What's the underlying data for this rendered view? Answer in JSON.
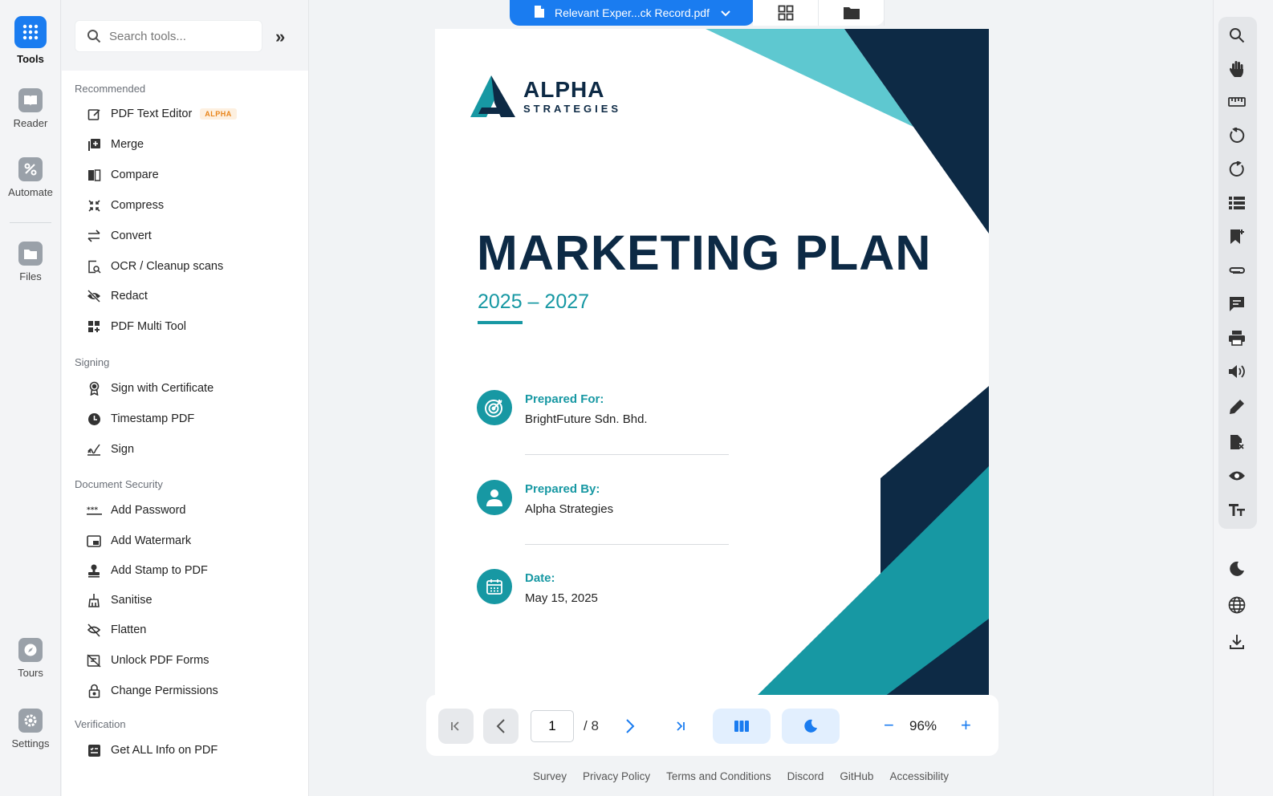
{
  "rail": {
    "items": [
      {
        "label": "Tools"
      },
      {
        "label": "Reader"
      },
      {
        "label": "Automate"
      },
      {
        "label": "Files"
      },
      {
        "label": "Tours"
      },
      {
        "label": "Settings"
      }
    ]
  },
  "tools_panel": {
    "search_placeholder": "Search tools...",
    "sections": [
      {
        "title": "Recommended",
        "items": [
          {
            "label": "PDF Text Editor",
            "badge": "ALPHA"
          },
          {
            "label": "Merge"
          },
          {
            "label": "Compare"
          },
          {
            "label": "Compress"
          },
          {
            "label": "Convert"
          },
          {
            "label": "OCR / Cleanup scans"
          },
          {
            "label": "Redact"
          },
          {
            "label": "PDF Multi Tool"
          }
        ]
      },
      {
        "title": "Signing",
        "items": [
          {
            "label": "Sign with Certificate"
          },
          {
            "label": "Timestamp PDF"
          },
          {
            "label": "Sign"
          }
        ]
      },
      {
        "title": "Document Security",
        "items": [
          {
            "label": "Add Password"
          },
          {
            "label": "Add Watermark"
          },
          {
            "label": "Add Stamp to PDF"
          },
          {
            "label": "Sanitise"
          },
          {
            "label": "Flatten"
          },
          {
            "label": "Unlock PDF Forms"
          },
          {
            "label": "Change Permissions"
          }
        ]
      },
      {
        "title": "Verification",
        "items": [
          {
            "label": "Get ALL Info on PDF"
          }
        ]
      }
    ]
  },
  "viewer": {
    "file_name": "Relevant Exper...ck Record.pdf",
    "document": {
      "brand_line1": "ALPHA",
      "brand_line2": "STRATEGIES",
      "title": "MARKETING PLAN",
      "years": "2025 – 2027",
      "info": [
        {
          "label": "Prepared For:",
          "value": "BrightFuture Sdn. Bhd."
        },
        {
          "label": "Prepared By:",
          "value": "Alpha Strategies"
        },
        {
          "label": "Date:",
          "value": "May 15, 2025"
        }
      ]
    },
    "nav": {
      "current_page": "1",
      "total": "/ 8",
      "zoom": "96%",
      "zoom_out": "−",
      "zoom_in": "+"
    }
  },
  "footer": {
    "links": [
      "Survey",
      "Privacy Policy",
      "Terms and Conditions",
      "Discord",
      "GitHub",
      "Accessibility"
    ]
  },
  "colors": {
    "accent": "#1a7cf0",
    "teal": "#1798a3",
    "navy": "#0d2a45",
    "light_teal": "#5ec8d0"
  }
}
